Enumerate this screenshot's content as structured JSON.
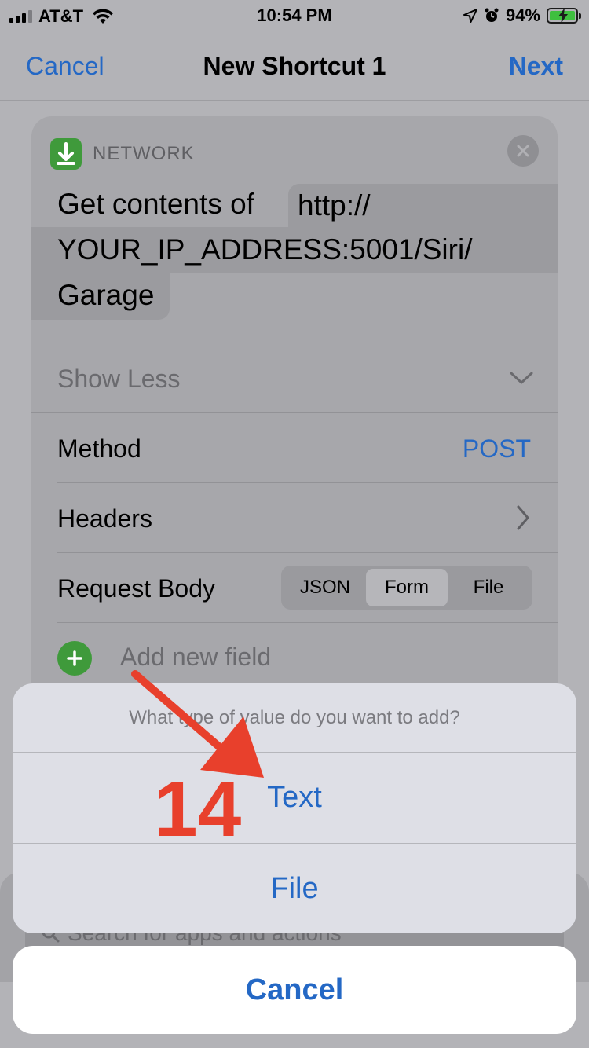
{
  "status_bar": {
    "carrier": "AT&T",
    "time": "10:54 PM",
    "battery": "94%",
    "signal_bars_filled": 3,
    "signal_bars_total": 4
  },
  "nav": {
    "cancel_label": "Cancel",
    "title": "New Shortcut 1",
    "next_label": "Next"
  },
  "action_card": {
    "category": "NETWORK",
    "prefix_text": "Get contents of",
    "url_part1": "http://",
    "url_part2": "YOUR_IP_ADDRESS:5001/Siri/",
    "url_part3": "Garage",
    "show_less_label": "Show Less",
    "method_label": "Method",
    "method_value": "POST",
    "headers_label": "Headers",
    "request_body_label": "Request Body",
    "body_options": [
      "JSON",
      "Form",
      "File"
    ],
    "body_selected": "Form",
    "add_field_label": "Add new field"
  },
  "search": {
    "placeholder": "Search for apps and actions"
  },
  "action_sheet": {
    "title": "What type of value do you want to add?",
    "options": [
      "Text",
      "File"
    ],
    "cancel_label": "Cancel"
  },
  "annotation": {
    "step_number": "14",
    "color": "#e8402c"
  },
  "colors": {
    "accent": "#2468c5",
    "network_green": "#3f9a3b",
    "battery_green": "#3fbf3f"
  },
  "icons": [
    "signal-icon",
    "wifi-icon",
    "location-icon",
    "alarm-icon",
    "battery-icon",
    "network-download-icon",
    "close-icon",
    "chevron-down-icon",
    "chevron-right-icon",
    "add-icon",
    "search-icon"
  ]
}
